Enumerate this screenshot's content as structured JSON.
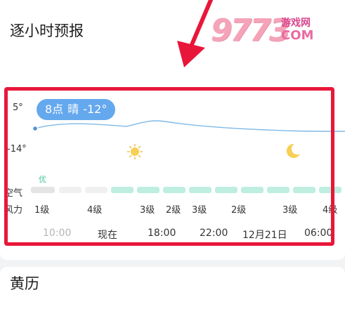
{
  "hourly": {
    "title": "逐小时预报",
    "temp_max": "5°",
    "temp_min": "-14°",
    "tooltip": {
      "time": "8点",
      "condition": "晴",
      "temp": "-12°"
    },
    "aqi_level": "优",
    "air_label": "空气",
    "wind_label": "风力",
    "wind": [
      "1级",
      "4级",
      "3级",
      "2级",
      "3级",
      "2级",
      "3级",
      "4级"
    ],
    "times": [
      "10:00",
      "现在",
      "18:00",
      "22:00",
      "12月21日",
      "06:00"
    ]
  },
  "almanac": {
    "title": "黄历"
  },
  "watermark": {
    "number": "9773",
    "cn": "游戏网",
    "com": "COM"
  },
  "colors": {
    "highlight_frame": "#e8173a",
    "tooltip": "#64a8ee",
    "aqi_good": "#bdeee0",
    "aqi_past": "#e4e4e4",
    "temp_line": "#7fb9e6"
  }
}
